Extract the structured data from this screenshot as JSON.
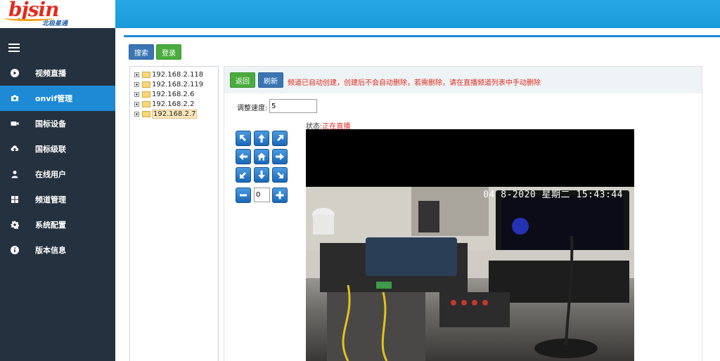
{
  "brand": {
    "logo_text": "bjsin",
    "logo_sub": "北极星通"
  },
  "sidebar": {
    "items": [
      {
        "label": "视频直播",
        "icon": "play-circle-icon",
        "active": false
      },
      {
        "label": "onvif管理",
        "icon": "camera-icon",
        "active": true
      },
      {
        "label": "国标设备",
        "icon": "video-camera-icon",
        "active": false
      },
      {
        "label": "国标级联",
        "icon": "cloud-upload-icon",
        "active": false
      },
      {
        "label": "在线用户",
        "icon": "user-icon",
        "active": false
      },
      {
        "label": "频道管理",
        "icon": "grid-icon",
        "active": false
      },
      {
        "label": "系统配置",
        "icon": "gear-icon",
        "active": false
      },
      {
        "label": "版本信息",
        "icon": "info-icon",
        "active": false
      }
    ]
  },
  "toolbar": {
    "search_label": "搜索",
    "login_label": "登录"
  },
  "tree": {
    "nodes": [
      {
        "label": "192.168.2.118",
        "selected": false
      },
      {
        "label": "192.168.2.119",
        "selected": false
      },
      {
        "label": "192.168.2.6",
        "selected": false
      },
      {
        "label": "192.168.2.2",
        "selected": false
      },
      {
        "label": "192.168.2.7",
        "selected": true
      }
    ]
  },
  "main": {
    "back_label": "返回",
    "refresh_label": "刷新",
    "notice": "频道已自动创建，创建后不会自动删除，若需删除，请在直播频道列表中手动删除",
    "speed_label": "调整速度:",
    "speed_value": "5",
    "zoom_value": "0",
    "status_label": "状态:",
    "status_value": "正在直播",
    "osd_timestamp": "04 8-2020 星期二 15:43:44"
  },
  "colors": {
    "accent": "#1e8ad6",
    "sidebar_bg": "#24313e",
    "topbar": "#1a9ad9",
    "notice": "#e32a1f"
  }
}
